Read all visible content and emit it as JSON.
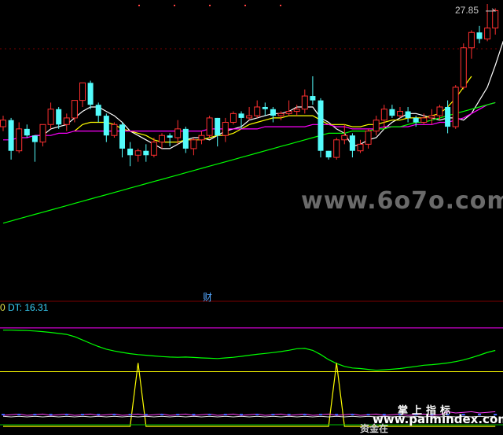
{
  "chart_data": [
    {
      "type": "candlestick",
      "price_label": "27.85",
      "upper_cut_label": "财",
      "up_color": "#ff3030",
      "down_color": "#54fcfc",
      "ma_colors": [
        "#ffffff",
        "#ffff00",
        "#ff00ff",
        "#00ff00"
      ],
      "ylim": [
        15.8,
        28.0
      ],
      "candles": [
        [
          22.4,
          22.9,
          22.2,
          22.7
        ],
        [
          22.7,
          22.8,
          20.9,
          21.3
        ],
        [
          21.3,
          22.6,
          21.2,
          22.3
        ],
        [
          22.3,
          22.5,
          21.9,
          22.0
        ],
        [
          22.0,
          22.0,
          20.8,
          21.7
        ],
        [
          21.7,
          22.4,
          21.5,
          22.5
        ],
        [
          22.5,
          23.5,
          22.3,
          23.2
        ],
        [
          23.2,
          23.3,
          22.3,
          22.5
        ],
        [
          22.5,
          23.0,
          22.2,
          22.8
        ],
        [
          22.8,
          23.6,
          22.6,
          23.6
        ],
        [
          23.6,
          24.4,
          23.3,
          24.4
        ],
        [
          24.4,
          24.5,
          23.2,
          23.4
        ],
        [
          23.4,
          23.5,
          22.6,
          22.9
        ],
        [
          22.9,
          23.0,
          21.7,
          22.0
        ],
        [
          22.0,
          22.6,
          21.9,
          22.5
        ],
        [
          22.5,
          22.6,
          21.0,
          21.4
        ],
        [
          21.4,
          21.7,
          20.6,
          21.1
        ],
        [
          21.1,
          21.4,
          20.8,
          21.3
        ],
        [
          21.3,
          21.6,
          20.8,
          21.1
        ],
        [
          21.1,
          21.9,
          21.0,
          21.7
        ],
        [
          21.7,
          22.1,
          21.4,
          22.0
        ],
        [
          22.0,
          22.1,
          21.5,
          21.9
        ],
        [
          21.9,
          22.7,
          21.6,
          22.3
        ],
        [
          22.3,
          22.4,
          21.2,
          21.4
        ],
        [
          21.4,
          21.9,
          21.1,
          21.8
        ],
        [
          21.8,
          22.2,
          21.6,
          22.0
        ],
        [
          22.0,
          22.9,
          21.9,
          22.8
        ],
        [
          22.8,
          22.8,
          21.5,
          22.0
        ],
        [
          22.0,
          22.8,
          21.7,
          22.6
        ],
        [
          22.6,
          23.1,
          22.5,
          23.0
        ],
        [
          23.0,
          23.1,
          22.3,
          22.8
        ],
        [
          22.8,
          23.3,
          22.7,
          22.9
        ],
        [
          22.9,
          23.6,
          22.8,
          23.3
        ],
        [
          23.3,
          23.5,
          22.9,
          23.2
        ],
        [
          23.2,
          23.3,
          22.6,
          22.9
        ],
        [
          22.9,
          23.1,
          22.7,
          23.0
        ],
        [
          23.0,
          23.6,
          22.9,
          23.1
        ],
        [
          23.1,
          23.4,
          22.9,
          23.2
        ],
        [
          23.2,
          24.1,
          23.0,
          23.8
        ],
        [
          23.8,
          24.7,
          23.4,
          23.6
        ],
        [
          23.6,
          23.7,
          21.0,
          21.3
        ],
        [
          21.3,
          21.3,
          20.9,
          21.0
        ],
        [
          21.0,
          21.9,
          20.9,
          21.8
        ],
        [
          21.8,
          22.5,
          21.6,
          22.0
        ],
        [
          22.0,
          22.1,
          21.0,
          21.3
        ],
        [
          21.3,
          21.8,
          21.2,
          21.6
        ],
        [
          21.6,
          22.3,
          21.4,
          22.2
        ],
        [
          22.2,
          22.9,
          22.0,
          22.7
        ],
        [
          22.7,
          23.4,
          22.3,
          23.2
        ],
        [
          23.2,
          23.4,
          22.8,
          22.9
        ],
        [
          22.9,
          23.3,
          22.8,
          23.1
        ],
        [
          23.1,
          23.3,
          22.6,
          22.8
        ],
        [
          22.8,
          22.9,
          22.4,
          22.6
        ],
        [
          22.6,
          23.0,
          22.5,
          22.8
        ],
        [
          22.8,
          23.2,
          22.5,
          22.9
        ],
        [
          22.9,
          23.4,
          22.7,
          23.3
        ],
        [
          23.3,
          23.6,
          22.1,
          22.4
        ],
        [
          22.4,
          24.3,
          22.3,
          24.2
        ],
        [
          24.2,
          26.2,
          24.1,
          26.0
        ],
        [
          26.0,
          26.8,
          25.5,
          26.7
        ],
        [
          26.7,
          27.0,
          26.2,
          26.4
        ],
        [
          26.4,
          28.0,
          26.3,
          26.9
        ],
        [
          26.9,
          27.8,
          26.6,
          27.7
        ]
      ],
      "moving_averages": [
        {
          "period": 5,
          "start": 4,
          "values": [
            22.0,
            22.0,
            22.3,
            22.4,
            22.5,
            22.8,
            23.1,
            23.3,
            23.3,
            23.1,
            22.9,
            22.6,
            22.2,
            22.0,
            21.8,
            21.6,
            21.4,
            21.4,
            21.6,
            21.8,
            21.9,
            21.9,
            21.8,
            22.0,
            22.2,
            22.3,
            22.4,
            22.7,
            22.8,
            22.9,
            23.0,
            23.0,
            23.1,
            23.3,
            23.3,
            23.3,
            22.8,
            22.6,
            22.3,
            22.1,
            21.5,
            21.6,
            21.8,
            21.9,
            22.3,
            22.6,
            22.8,
            23.0,
            23.0,
            22.9,
            22.8,
            22.7,
            22.8,
            22.8,
            22.7,
            23.0,
            23.6,
            24.2,
            25.2,
            26.3,
            26.6
          ]
        },
        {
          "period": 10,
          "start": 9,
          "values": [
            22.2,
            22.5,
            22.6,
            22.6,
            22.6,
            22.5,
            22.3,
            22.2,
            22.1,
            22.0,
            21.8,
            21.7,
            21.7,
            21.7,
            21.8,
            21.8,
            21.8,
            21.9,
            22.0,
            22.0,
            22.1,
            22.3,
            22.5,
            22.6,
            22.7,
            22.8,
            22.8,
            22.9,
            22.9,
            22.9,
            22.9,
            22.7,
            22.5,
            22.5,
            22.5,
            22.4,
            22.4,
            22.5,
            22.5,
            22.6,
            22.7,
            22.7,
            22.8,
            22.8,
            22.8,
            22.9,
            23.0,
            23.3,
            23.7,
            24.2,
            24.7
          ]
        },
        {
          "period": 30,
          "start": 0,
          "values": [
            21.8,
            21.8,
            21.9,
            21.9,
            22.0,
            22.0,
            22.0,
            22.1,
            22.1,
            22.2,
            22.2,
            22.2,
            22.2,
            22.2,
            22.2,
            22.2,
            22.2,
            22.2,
            22.2,
            22.2,
            22.2,
            22.2,
            22.2,
            22.2,
            22.2,
            22.2,
            22.3,
            22.3,
            22.3,
            22.3,
            22.3,
            22.3,
            22.3,
            22.4,
            22.4,
            22.4,
            22.4,
            22.4,
            22.4,
            22.5,
            22.5,
            22.5,
            22.4,
            22.4,
            22.3,
            22.3,
            22.3,
            22.3,
            22.4,
            22.4,
            22.4,
            22.4,
            22.5,
            22.5,
            22.5,
            22.6,
            22.6,
            22.7,
            22.8,
            23.0,
            23.2,
            23.4,
            23.5
          ]
        },
        {
          "period": 60,
          "start": 0,
          "values": [
            18.0,
            18.1,
            18.2,
            18.3,
            18.4,
            18.5,
            18.6,
            18.7,
            18.8,
            18.9,
            19.0,
            19.1,
            19.2,
            19.3,
            19.4,
            19.5,
            19.6,
            19.7,
            19.8,
            19.9,
            20.0,
            20.1,
            20.2,
            20.3,
            20.4,
            20.5,
            20.6,
            20.7,
            20.8,
            20.9,
            21.0,
            21.1,
            21.2,
            21.3,
            21.4,
            21.5,
            21.6,
            21.7,
            21.8,
            21.9,
            22.0,
            22.1,
            22.1,
            22.1,
            22.2,
            22.2,
            22.2,
            22.3,
            22.3,
            22.4,
            22.4,
            22.5,
            22.6,
            22.6,
            22.7,
            22.8,
            22.9,
            23.0,
            23.1,
            23.2,
            23.3,
            23.4,
            23.5
          ]
        }
      ]
    },
    {
      "type": "line",
      "prefix_label": "0",
      "value_label": "DT: 16.31",
      "ylim": [
        0,
        100
      ],
      "levels": [
        {
          "value": 90,
          "color": "#ff00ff"
        },
        {
          "value": 50,
          "color": "#ffff00"
        }
      ],
      "series": [
        {
          "color": "#00ff00",
          "values": [
            88.0,
            88.0,
            87.8,
            87.6,
            87.2,
            86.6,
            85.9,
            85.0,
            84.1,
            82.0,
            79.0,
            75.9,
            73.0,
            70.6,
            68.9,
            67.6,
            66.5,
            65.6,
            65.0,
            64.4,
            63.8,
            63.4,
            63.2,
            63.4,
            63.0,
            62.6,
            62.3,
            62.0,
            62.6,
            63.2,
            64.0,
            65.0,
            65.9,
            66.7,
            67.5,
            68.4,
            69.6,
            71.0,
            71.3,
            69.5,
            65.7,
            61.0,
            57.5,
            54.8,
            53.4,
            52.9,
            52.1,
            51.3,
            51.7,
            52.2,
            52.9,
            53.9,
            54.8,
            55.9,
            56.4,
            57.1,
            58.0,
            59.2,
            60.7,
            62.8,
            65.1,
            67.6,
            69.4
          ]
        },
        {
          "color": "#ffff00",
          "values": [
            0,
            0,
            0,
            0,
            0,
            0,
            0,
            0,
            0,
            0,
            0,
            0,
            0,
            0,
            0,
            0,
            0,
            0,
            0,
            0,
            0,
            0,
            0,
            0,
            0,
            0,
            0,
            0,
            0,
            0,
            0,
            0,
            0,
            0,
            0,
            0,
            0,
            0,
            0,
            0,
            0,
            0,
            0,
            0,
            0,
            0,
            0,
            0,
            0,
            0,
            0,
            0,
            0,
            0,
            0,
            0,
            0,
            0,
            0,
            0,
            0,
            0,
            0
          ],
          "spikes": [
            {
              "index": 17,
              "value": 58
            },
            {
              "index": 42,
              "value": 58
            }
          ]
        }
      ]
    }
  ],
  "watermarks": {
    "site_big": "www.6o7o.com",
    "brand_line": "掌上指标",
    "site_small": "www.palmindex.com",
    "footer_partial": "资金在"
  }
}
